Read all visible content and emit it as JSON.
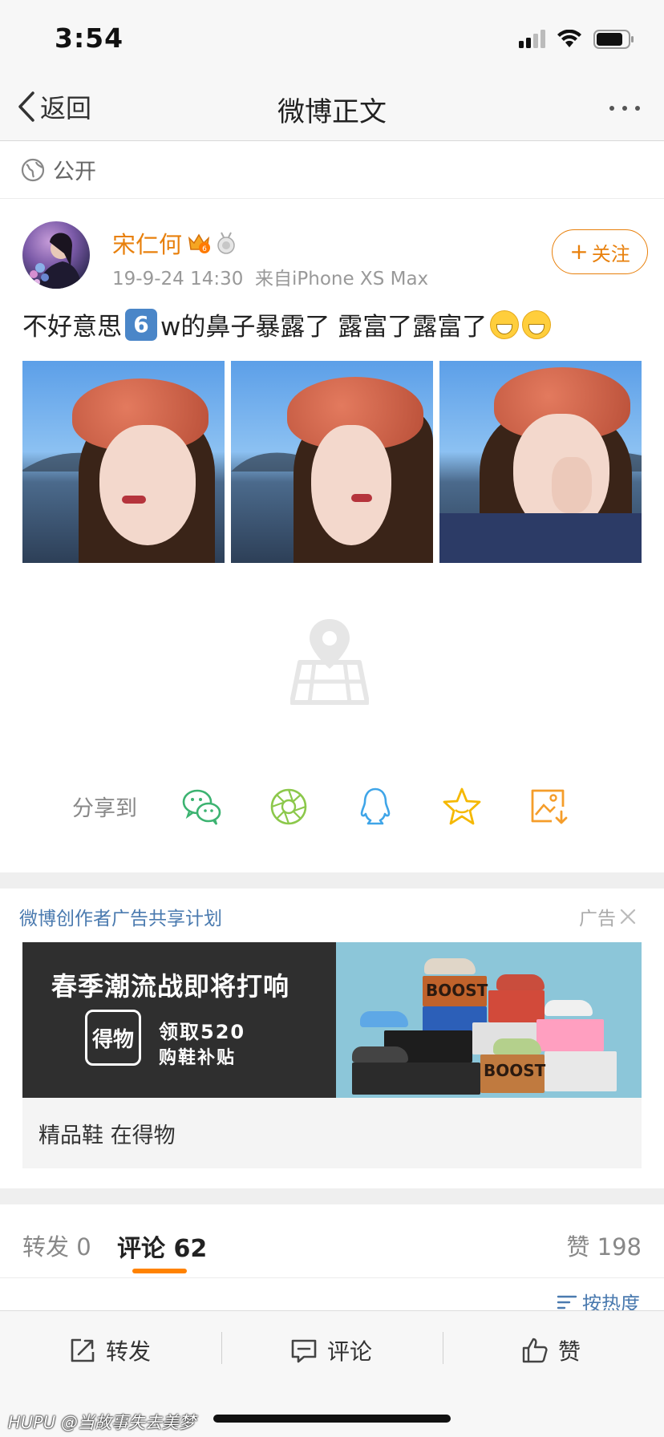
{
  "status_bar": {
    "time": "3:54"
  },
  "nav": {
    "back_label": "返回",
    "title": "微博正文"
  },
  "privacy": {
    "label": "公开"
  },
  "author": {
    "name": "宋仁何",
    "date": "19-9-24 14:30",
    "source": "来自iPhone XS Max",
    "follow_label": "关注"
  },
  "post": {
    "text_prefix": "不好意思",
    "emoji_number": "6",
    "text_main": "w的鼻子暴露了 露富了露富了"
  },
  "share": {
    "label": "分享到",
    "targets": [
      "wechat",
      "moments",
      "qq",
      "favorite",
      "save-image"
    ]
  },
  "ad": {
    "program_label": "微博创作者广告共享计划",
    "tag": "广告",
    "headline": "春季潮流战即将打响",
    "logo_text": "得物",
    "offer_line1": "领取520",
    "offer_line2": "购鞋补贴",
    "box_text_top": "BOOST",
    "box_text_bottom": "BOOST",
    "caption": "精品鞋 在得物"
  },
  "tabs": {
    "repost_label": "转发",
    "repost_count": "0",
    "comment_label": "评论",
    "comment_count": "62",
    "like_label": "赞",
    "like_count": "198"
  },
  "sort": {
    "label": "按热度"
  },
  "bottom_bar": {
    "repost": "转发",
    "comment": "评论",
    "like": "赞"
  },
  "watermark": {
    "brand": "HUPU",
    "handle": "@当故事失去美梦"
  },
  "colors": {
    "accent": "#ff8200",
    "name_orange": "#e8800c",
    "link_blue": "#4a7aaf"
  }
}
